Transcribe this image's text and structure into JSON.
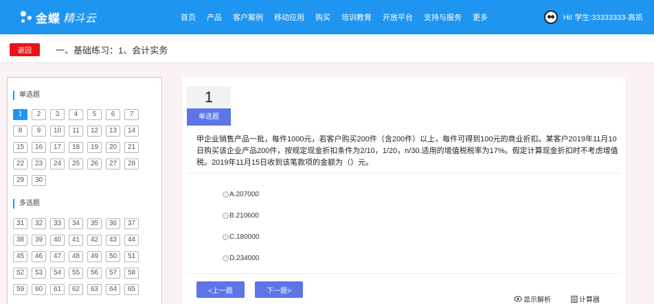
{
  "header": {
    "logo_name": "金蝶",
    "logo_sub": "精斗云",
    "nav": [
      "首页",
      "产品",
      "客户案例",
      "移动应用",
      "购买",
      "培训教育",
      "开放平台",
      "支持与服务",
      "更多"
    ],
    "user_text": "Hi! 学生:33333333-高凯"
  },
  "subbar": {
    "back_label": "返回",
    "title": "一、基础练习：1、会计实务"
  },
  "sidebar": {
    "sections": [
      {
        "title": "单选题",
        "numbers": [
          "1",
          "2",
          "3",
          "4",
          "5",
          "6",
          "7",
          "8",
          "9",
          "10",
          "11",
          "12",
          "13",
          "14",
          "15",
          "16",
          "17",
          "18",
          "19",
          "20",
          "21",
          "22",
          "23",
          "24",
          "25",
          "26",
          "27",
          "28",
          "29",
          "30"
        ],
        "active": "1"
      },
      {
        "title": "多选题",
        "numbers": [
          "31",
          "32",
          "33",
          "34",
          "35",
          "36",
          "37",
          "38",
          "39",
          "40",
          "41",
          "42",
          "43",
          "44",
          "45",
          "46",
          "47",
          "48",
          "49",
          "50",
          "51",
          "52",
          "53",
          "54",
          "55",
          "56",
          "57",
          "58",
          "59",
          "60",
          "61",
          "62",
          "63",
          "64",
          "65"
        ]
      }
    ]
  },
  "question": {
    "number": "1",
    "type": "单选题",
    "text": "甲企业销售产品一批，每件1000元，若客户购买200件（含200件）以上，每件可得到100元的商业折扣。某客户2019年11月10日购买该企业产品200件，按规定现金折扣条件为2/10，1/20，n/30.适用的增值税税率为17%。假定计算现金折扣时不考虑增值税。2019年11月15日收到该笔款项的金额为（）元。",
    "options": [
      "A.207000",
      "B.210600",
      "C.180000",
      "D.234000"
    ]
  },
  "controls": {
    "prev_label": "<上一题",
    "next_label": "下一题>",
    "analysis_label": "显示解析",
    "calculator_label": "计算器"
  },
  "colors": {
    "brand": "#1e95f1",
    "button": "#5d75e7",
    "back": "#e8141b"
  }
}
